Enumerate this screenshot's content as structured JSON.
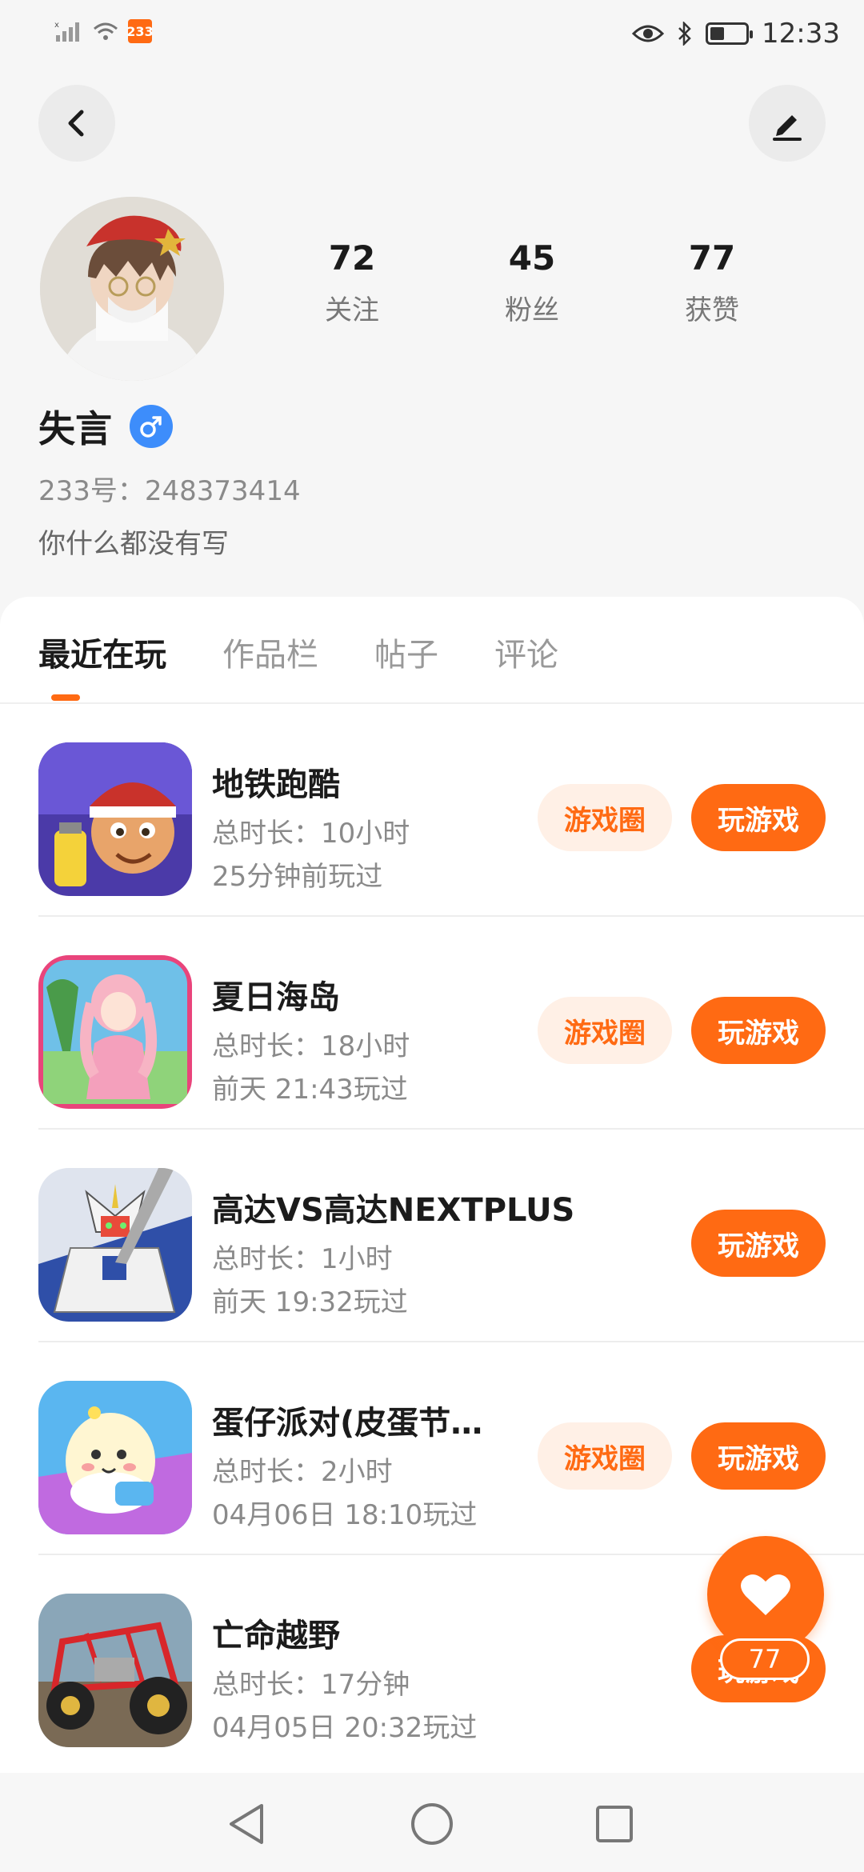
{
  "status_bar": {
    "time": "12:33",
    "battery_level": 0.35,
    "app_badge": "233"
  },
  "profile": {
    "name": "失言",
    "id_text": "233号：248373414",
    "bio": "你什么都没有写",
    "stats": [
      {
        "value": "72",
        "label": "关注"
      },
      {
        "value": "45",
        "label": "粉丝"
      },
      {
        "value": "77",
        "label": "获赞"
      }
    ]
  },
  "tabs": [
    "最近在玩",
    "作品栏",
    "帖子",
    "评论"
  ],
  "buttons": {
    "circle": "游戏圈",
    "play": "玩游戏"
  },
  "games": [
    {
      "title": "地铁跑酷",
      "duration": "总时长：10小时",
      "last_played": "25分钟前玩过",
      "has_circle": true
    },
    {
      "title": "夏日海岛",
      "duration": "总时长：18小时",
      "last_played": "前天 21:43玩过",
      "has_circle": true
    },
    {
      "title": "高达VS高达NEXTPLUS",
      "duration": "总时长：1小时",
      "last_played": "前天 19:32玩过",
      "has_circle": false
    },
    {
      "title": "蛋仔派对(皮蛋节…",
      "duration": "总时长：2小时",
      "last_played": "04月06日 18:10玩过",
      "has_circle": true
    },
    {
      "title": "亡命越野",
      "duration": "总时长：17分钟",
      "last_played": "04月05日 20:32玩过",
      "has_circle": false
    }
  ],
  "likes_fab": {
    "count": "77",
    "icon": "heart-icon"
  },
  "colors": {
    "accent": "#ff6a13",
    "accent_light": "#fff0e6",
    "gender_blue": "#3d8dfb"
  }
}
